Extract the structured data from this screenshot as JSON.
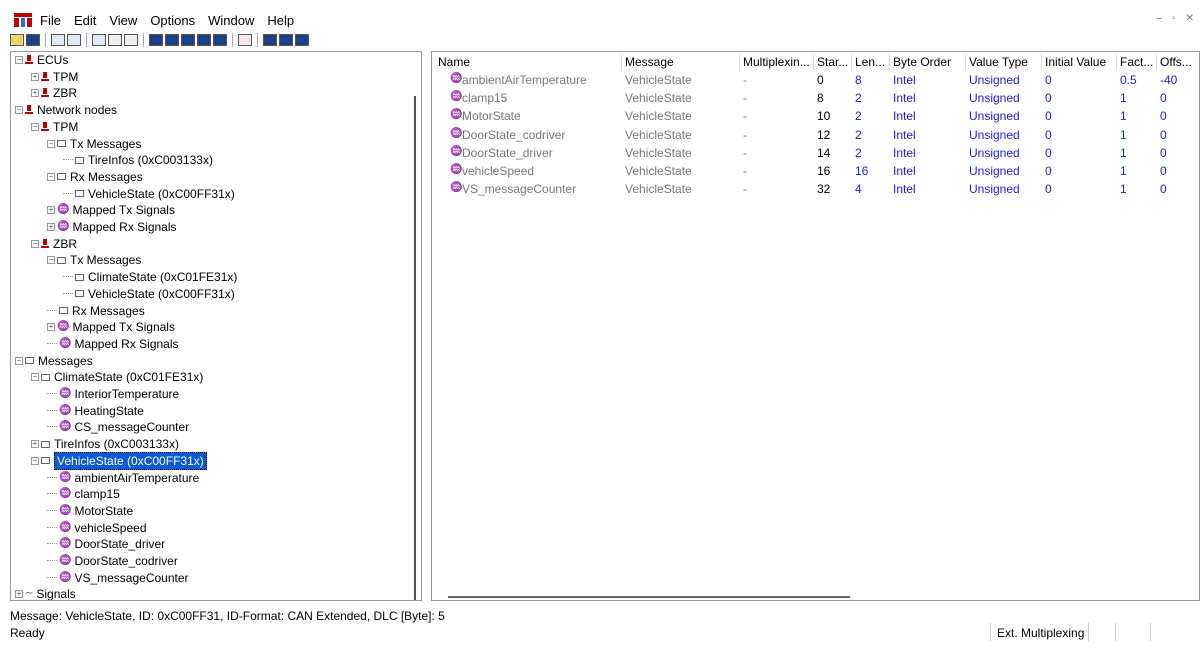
{
  "menubar": {
    "items": [
      "File",
      "Edit",
      "View",
      "Options",
      "Window",
      "Help"
    ]
  },
  "tree": [
    {
      "label": "ECUs",
      "level": 0,
      "icon": "ecu-icon",
      "expander": "−"
    },
    {
      "label": "TPM",
      "level": 1,
      "icon": "ecu-icon",
      "expander": "+"
    },
    {
      "label": "ZBR",
      "level": 1,
      "icon": "ecu-icon",
      "expander": "+"
    },
    {
      "label": "Network nodes",
      "level": 0,
      "icon": "ecu-icon",
      "expander": "−"
    },
    {
      "label": "TPM",
      "level": 1,
      "icon": "ecu-icon",
      "expander": "−"
    },
    {
      "label": "Tx Messages",
      "level": 2,
      "icon": "message-icon",
      "expander": "−"
    },
    {
      "label": "TireInfos (0xC003133x)",
      "level": 3,
      "icon": "message-icon",
      "expander": ""
    },
    {
      "label": "Rx Messages",
      "level": 2,
      "icon": "message-icon",
      "expander": "−"
    },
    {
      "label": "VehicleState (0xC00FF31x)",
      "level": 3,
      "icon": "message-icon",
      "expander": ""
    },
    {
      "label": "Mapped Tx Signals",
      "level": 2,
      "icon": "mapped-tx-icon",
      "expander": "+"
    },
    {
      "label": "Mapped Rx Signals",
      "level": 2,
      "icon": "mapped-rx-icon",
      "expander": "+"
    },
    {
      "label": "ZBR",
      "level": 1,
      "icon": "ecu-icon",
      "expander": "−"
    },
    {
      "label": "Tx Messages",
      "level": 2,
      "icon": "message-icon",
      "expander": "−"
    },
    {
      "label": "ClimateState (0xC01FE31x)",
      "level": 3,
      "icon": "message-icon",
      "expander": ""
    },
    {
      "label": "VehicleState (0xC00FF31x)",
      "level": 3,
      "icon": "message-icon",
      "expander": ""
    },
    {
      "label": "Rx Messages",
      "level": 2,
      "icon": "message-icon",
      "expander": ""
    },
    {
      "label": "Mapped Tx Signals",
      "level": 2,
      "icon": "mapped-tx-icon",
      "expander": "+"
    },
    {
      "label": "Mapped Rx Signals",
      "level": 2,
      "icon": "mapped-rx-icon",
      "expander": ""
    },
    {
      "label": "Messages",
      "level": 0,
      "icon": "message-icon",
      "expander": "−"
    },
    {
      "label": "ClimateState (0xC01FE31x)",
      "level": 1,
      "icon": "message-icon",
      "expander": "−"
    },
    {
      "label": "InteriorTemperature",
      "level": 2,
      "icon": "signal-icon",
      "expander": ""
    },
    {
      "label": "HeatingState",
      "level": 2,
      "icon": "signal-icon",
      "expander": ""
    },
    {
      "label": "CS_messageCounter",
      "level": 2,
      "icon": "signal-icon",
      "expander": ""
    },
    {
      "label": "TireInfos (0xC003133x)",
      "level": 1,
      "icon": "message-icon",
      "expander": "+"
    },
    {
      "label": "VehicleState (0xC00FF31x)",
      "level": 1,
      "icon": "message-icon",
      "expander": "−",
      "selected": true
    },
    {
      "label": "ambientAirTemperature",
      "level": 2,
      "icon": "signal-icon",
      "expander": ""
    },
    {
      "label": "clamp15",
      "level": 2,
      "icon": "signal-icon",
      "expander": ""
    },
    {
      "label": "MotorState",
      "level": 2,
      "icon": "signal-icon",
      "expander": ""
    },
    {
      "label": "vehicleSpeed",
      "level": 2,
      "icon": "signal-icon",
      "expander": ""
    },
    {
      "label": "DoorState_driver",
      "level": 2,
      "icon": "signal-icon",
      "expander": ""
    },
    {
      "label": "DoorState_codriver",
      "level": 2,
      "icon": "signal-icon",
      "expander": ""
    },
    {
      "label": "VS_messageCounter",
      "level": 2,
      "icon": "signal-icon",
      "expander": ""
    },
    {
      "label": "Signals",
      "level": 0,
      "icon": "signals-wave-icon",
      "expander": "+"
    }
  ],
  "grid": {
    "columns": [
      "Name",
      "Message",
      "Multiplexin...",
      "Star...",
      "Len...",
      "Byte Order",
      "Value Type",
      "Initial Value",
      "Fact...",
      "Offs..."
    ],
    "rows": [
      [
        "ambientAirTemperature",
        "VehicleState",
        "-",
        "0",
        "8",
        "Intel",
        "Unsigned",
        "0",
        "0.5",
        "-40"
      ],
      [
        "clamp15",
        "VehicleState",
        "-",
        "8",
        "2",
        "Intel",
        "Unsigned",
        "0",
        "1",
        "0"
      ],
      [
        "MotorState",
        "VehicleState",
        "-",
        "10",
        "2",
        "Intel",
        "Unsigned",
        "0",
        "1",
        "0"
      ],
      [
        "DoorState_codriver",
        "VehicleState",
        "-",
        "12",
        "2",
        "Intel",
        "Unsigned",
        "0",
        "1",
        "0"
      ],
      [
        "DoorState_driver",
        "VehicleState",
        "-",
        "14",
        "2",
        "Intel",
        "Unsigned",
        "0",
        "1",
        "0"
      ],
      [
        "vehicleSpeed",
        "VehicleState",
        "-",
        "16",
        "16",
        "Intel",
        "Unsigned",
        "0",
        "1",
        "0"
      ],
      [
        "VS_messageCounter",
        "VehicleState",
        "-",
        "32",
        "4",
        "Intel",
        "Unsigned",
        "0",
        "1",
        "0"
      ]
    ]
  },
  "status": {
    "message_info": "Message: VehicleState,   ID: 0xC00FF31,   ID-Format: CAN Extended,   DLC [Byte]: 5",
    "ready": "Ready",
    "ext_mux": "Ext. Multiplexing"
  },
  "colors": {
    "selection": "#0a5ad6",
    "value_blue": "#1a1af0",
    "ecu_red": "#c00000"
  }
}
